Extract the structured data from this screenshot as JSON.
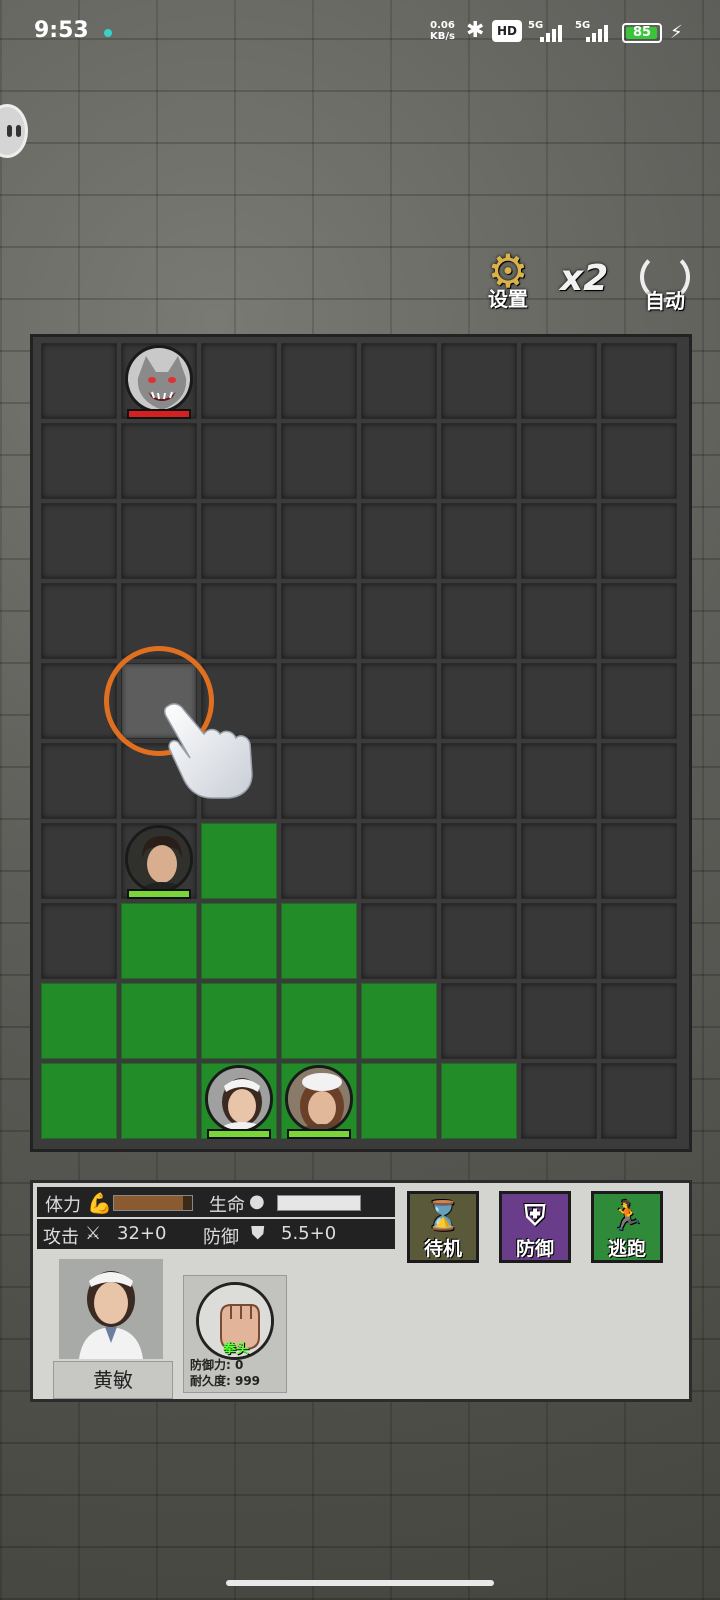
{
  "status_bar": {
    "time": "9:53",
    "net_speed_value": "0.06",
    "net_speed_unit": "KB/s",
    "hd_label": "HD",
    "signal_1": "5G",
    "signal_2": "5G",
    "battery": "85"
  },
  "controls": {
    "settings_label": "设置",
    "speed_label": "x2",
    "auto_label": "自动"
  },
  "board": {
    "columns": 8,
    "rows": 10,
    "green_cells": [
      "6-2",
      "7-1",
      "7-2",
      "7-3",
      "8-0",
      "8-1",
      "8-2",
      "8-3",
      "8-4",
      "9-0",
      "9-1",
      "9-2",
      "9-3",
      "9-4",
      "9-5"
    ],
    "highlight_cell": "4-1",
    "units": [
      {
        "id": "enemy-wolf",
        "type": "enemy",
        "row": 0,
        "col": 1,
        "hp_color": "#d32020"
      },
      {
        "id": "hero-man",
        "type": "ally",
        "row": 6,
        "col": 1,
        "hp_color": "#79d53a"
      },
      {
        "id": "hero-nurse",
        "type": "ally",
        "row": 9,
        "col": 2,
        "hp_color": "#79d53a"
      },
      {
        "id": "hero-chef",
        "type": "ally",
        "row": 9,
        "col": 3,
        "hp_color": "#79d53a"
      }
    ]
  },
  "panel": {
    "stamina_label": "体力",
    "stamina_fraction": 0.88,
    "life_label": "生命",
    "life_fraction": 1.0,
    "attack_label": "攻击",
    "attack_value": "32+0",
    "defense_label": "防御",
    "defense_value": "5.5+0",
    "actions": [
      {
        "label": "待机",
        "color": "#5a5a3a"
      },
      {
        "label": "防御",
        "color": "#6a3d8a"
      },
      {
        "label": "逃跑",
        "color": "#2f8a3a"
      }
    ],
    "character_name": "黄敏",
    "weapon": {
      "name": "拳头",
      "defense_text": "防御力: 0",
      "durability_text": "耐久度: 999"
    }
  },
  "colors": {
    "green_cell": "#228c28",
    "empty_cell": "#383838",
    "pointer_ring": "#e07020"
  }
}
